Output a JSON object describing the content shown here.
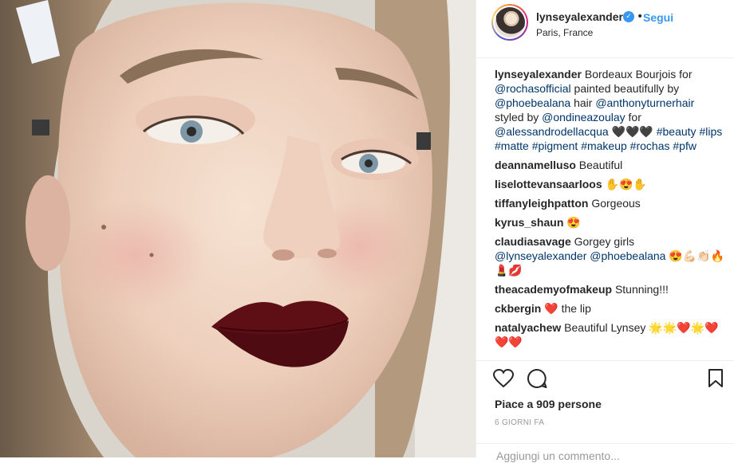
{
  "post": {
    "username": "lynseyalexander",
    "verified_icon": "verified-badge-icon",
    "dot": "•",
    "follow_label": "Segui",
    "location": "Paris, France"
  },
  "caption": {
    "user": "lynseyalexander",
    "parts": [
      {
        "text": " Bordeaux Bourjois for ",
        "link": false
      },
      {
        "text": "@rochasofficial",
        "link": true
      },
      {
        "text": " painted beautifully by ",
        "link": false
      },
      {
        "text": "@phoebealana",
        "link": true
      },
      {
        "text": " hair ",
        "link": false
      },
      {
        "text": "@anthonyturnerhair",
        "link": true
      },
      {
        "text": " styled by ",
        "link": false
      },
      {
        "text": "@ondineazoulay",
        "link": true
      },
      {
        "text": " for ",
        "link": false
      },
      {
        "text": "@alessandrodellacqua",
        "link": true
      },
      {
        "text": " 🖤🖤🖤 ",
        "link": false
      },
      {
        "text": "#beauty",
        "link": true
      },
      {
        "text": " ",
        "link": false
      },
      {
        "text": "#lips",
        "link": true
      },
      {
        "text": " ",
        "link": false
      },
      {
        "text": "#matte",
        "link": true
      },
      {
        "text": " ",
        "link": false
      },
      {
        "text": "#pigment",
        "link": true
      },
      {
        "text": " ",
        "link": false
      },
      {
        "text": "#makeup",
        "link": true
      },
      {
        "text": " ",
        "link": false
      },
      {
        "text": "#rochas",
        "link": true
      },
      {
        "text": " ",
        "link": false
      },
      {
        "text": "#pfw",
        "link": true
      }
    ]
  },
  "comments": [
    {
      "user": "deannamelluso",
      "parts": [
        {
          "text": " Beautiful",
          "link": false
        }
      ]
    },
    {
      "user": "liselottevansaarloos",
      "parts": [
        {
          "text": " ✋😍✋",
          "link": false
        }
      ]
    },
    {
      "user": "tiffanyleighpatton",
      "parts": [
        {
          "text": " Gorgeous",
          "link": false
        }
      ]
    },
    {
      "user": "kyrus_shaun",
      "parts": [
        {
          "text": " 😍",
          "link": false
        }
      ]
    },
    {
      "user": "claudiasavage",
      "parts": [
        {
          "text": " Gorgey girls ",
          "link": false
        },
        {
          "text": "@lynseyalexander",
          "link": true
        },
        {
          "text": " ",
          "link": false
        },
        {
          "text": "@phoebealana",
          "link": true
        },
        {
          "text": " 😍💪🏻👏🏻🔥💄💋",
          "link": false
        }
      ]
    },
    {
      "user": "theacademyofmakeup",
      "parts": [
        {
          "text": " Stunning!!!",
          "link": false
        }
      ]
    },
    {
      "user": "ckbergin",
      "parts": [
        {
          "text": " ❤️ the lip",
          "link": false
        }
      ]
    },
    {
      "user": "natalyachew",
      "parts": [
        {
          "text": " Beautiful Lynsey 🌟🌟❤️🌟❤️❤️❤️",
          "link": false
        }
      ]
    }
  ],
  "actions": {
    "like_icon": "heart-icon",
    "comment_icon": "comment-icon",
    "save_icon": "bookmark-icon",
    "likes_text": "Piace a 909 persone",
    "time_text": "6 GIORNI FA",
    "comment_placeholder": "Aggiungi un commento..."
  },
  "colors": {
    "link": "#003569",
    "follow": "#3897f0",
    "lipstick": "#5e0f16"
  }
}
